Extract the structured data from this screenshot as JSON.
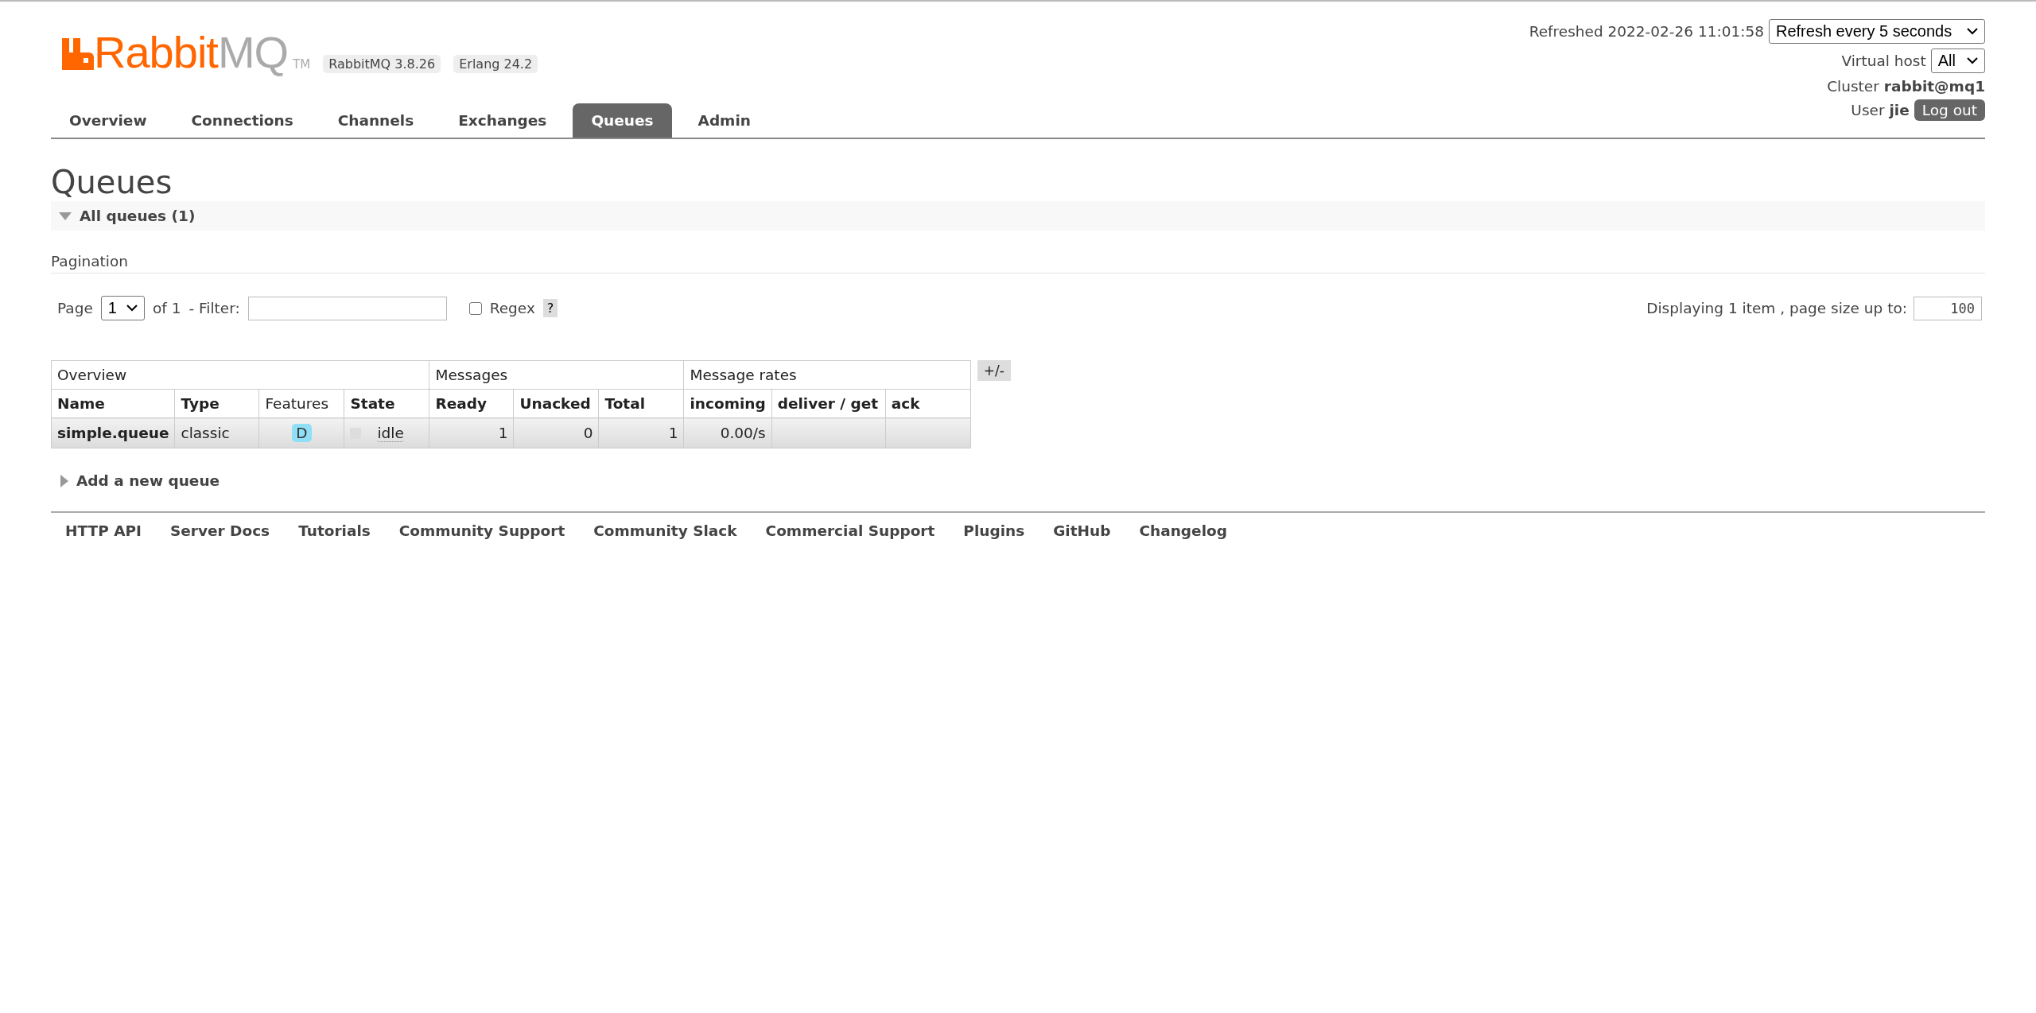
{
  "logo": {
    "parts": [
      "Rabbit",
      "MQ"
    ],
    "trademark": "TM"
  },
  "badges": [
    "RabbitMQ 3.8.26",
    "Erlang 24.2"
  ],
  "tabs": [
    {
      "label": "Overview",
      "selected": false
    },
    {
      "label": "Connections",
      "selected": false
    },
    {
      "label": "Channels",
      "selected": false
    },
    {
      "label": "Exchanges",
      "selected": false
    },
    {
      "label": "Queues",
      "selected": true
    },
    {
      "label": "Admin",
      "selected": false
    }
  ],
  "status": {
    "refreshed": "Refreshed 2022-02-26 11:01:58",
    "refresh_select": "Refresh every 5 seconds",
    "vhost_label": "Virtual host",
    "vhost_select": "All",
    "cluster_label": "Cluster",
    "cluster": "rabbit@mq1",
    "user_label": "User",
    "user": "jie",
    "logout": "Log out"
  },
  "page_title": "Queues",
  "section": {
    "title": "All queues (1)",
    "expanded": true
  },
  "pagination": {
    "heading": "Pagination",
    "page_label": "Page",
    "page_select": "1",
    "of": "of 1",
    "filter_label": "- Filter:",
    "regex_label": "Regex",
    "regex_checked": false,
    "help": "?",
    "displaying": "Displaying 1 item , page size up to:",
    "page_size": "100"
  },
  "table": {
    "groups": [
      {
        "label": "Overview",
        "columns": [
          {
            "label": "Name",
            "sortable": true
          },
          {
            "label": "Type",
            "sortable": true
          },
          {
            "label": "Features",
            "sortable": false
          },
          {
            "label": "State",
            "sortable": true
          }
        ]
      },
      {
        "label": "Messages",
        "columns": [
          {
            "label": "Ready",
            "sortable": true
          },
          {
            "label": "Unacked",
            "sortable": true
          },
          {
            "label": "Total",
            "sortable": true
          }
        ]
      },
      {
        "label": "Message rates",
        "columns": [
          {
            "label": "incoming",
            "sortable": true
          },
          {
            "label": "deliver / get",
            "sortable": true
          },
          {
            "label": "ack",
            "sortable": true
          }
        ]
      }
    ],
    "columns_toggle": "+/-",
    "rows": [
      {
        "cells": [
          {
            "kind": "link",
            "text": "simple.queue"
          },
          {
            "kind": "text",
            "text": "classic"
          },
          {
            "kind": "tag",
            "text": "D"
          },
          {
            "kind": "state",
            "text": "idle"
          },
          {
            "kind": "number",
            "text": "1"
          },
          {
            "kind": "number",
            "text": "0"
          },
          {
            "kind": "number",
            "text": "1"
          },
          {
            "kind": "number",
            "text": "0.00/s"
          },
          {
            "kind": "empty"
          },
          {
            "kind": "empty"
          }
        ]
      }
    ]
  },
  "add_section": {
    "title": "Add a new queue",
    "expanded": false
  },
  "footer": [
    "HTTP API",
    "Server Docs",
    "Tutorials",
    "Community Support",
    "Community Slack",
    "Commercial Support",
    "Plugins",
    "GitHub",
    "Changelog"
  ]
}
